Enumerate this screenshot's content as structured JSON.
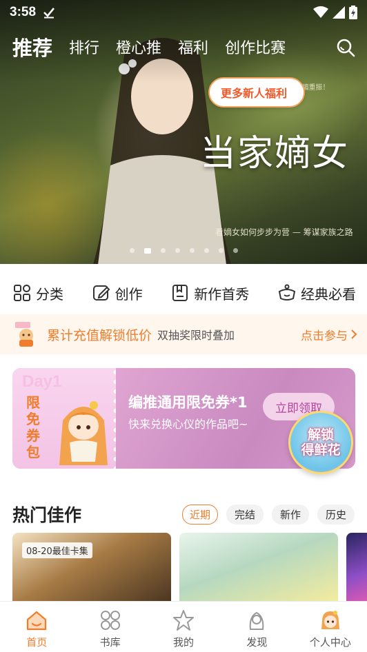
{
  "status_bar": {
    "time": "3:58"
  },
  "top_tabs": [
    {
      "label": "推荐",
      "active": true
    },
    {
      "label": "排行",
      "active": false
    },
    {
      "label": "橙心推",
      "active": false
    },
    {
      "label": "福利",
      "active": false
    },
    {
      "label": "创作比赛",
      "active": false
    }
  ],
  "hero": {
    "title": "当家嫡女",
    "caption": "手绘精品 · 庶女逆袭，嫡女门楣重振！",
    "subcaption": "看嫡女如何步步为营 — 筹谋家族之路",
    "slide_count": 8,
    "active_slide": 1
  },
  "quick_nav": [
    {
      "label": "分类",
      "icon": "grid-icon"
    },
    {
      "label": "创作",
      "icon": "edit-icon"
    },
    {
      "label": "新作首秀",
      "icon": "bookmark-icon"
    },
    {
      "label": "经典必看",
      "icon": "crown-icon"
    }
  ],
  "promo": {
    "main": "累计充值解锁低价",
    "sub": "双抽奖限时叠加",
    "cta": "点击参与"
  },
  "coupon": {
    "day": "Day1",
    "vertical_label": "限免券包",
    "title": "编推通用限免券*1",
    "desc": "快来兑换心仪的作品吧~",
    "claim": "立即领取",
    "more": "更多新人福利",
    "badge_line1": "解锁",
    "badge_line2": "得鲜花"
  },
  "hot": {
    "title": "热门佳作",
    "filters": [
      {
        "label": "近期",
        "active": true
      },
      {
        "label": "完结",
        "active": false
      },
      {
        "label": "新作",
        "active": false
      },
      {
        "label": "历史",
        "active": false
      }
    ],
    "card_badge": "08-20最佳卡集"
  },
  "bottom_nav": [
    {
      "label": "首页",
      "icon": "home-icon",
      "active": true
    },
    {
      "label": "书库",
      "icon": "library-icon",
      "active": false
    },
    {
      "label": "我的",
      "icon": "star-icon",
      "active": false
    },
    {
      "label": "发现",
      "icon": "discover-icon",
      "active": false
    },
    {
      "label": "个人中心",
      "icon": "avatar-icon",
      "active": false
    }
  ],
  "colors": {
    "accent": "#f07d2c",
    "coupon": "#d68fc2"
  }
}
